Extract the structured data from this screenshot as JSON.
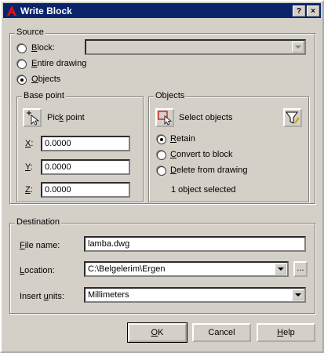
{
  "window": {
    "title": "Write Block",
    "help_button": "?",
    "close_button": "×"
  },
  "source": {
    "legend": "Source",
    "block_label": "Block:",
    "entire_drawing_label": "Entire drawing",
    "objects_label": "Objects",
    "selected": "Objects",
    "block_value": ""
  },
  "base_point": {
    "legend": "Base point",
    "pick_point_label": "Pick point",
    "x_label": "X:",
    "x_value": "0.0000",
    "y_label": "Y:",
    "y_value": "0.0000",
    "z_label": "Z:",
    "z_value": "0.0000"
  },
  "objects": {
    "legend": "Objects",
    "select_objects_label": "Select objects",
    "retain_label": "Retain",
    "convert_label": "Convert to block",
    "delete_label": "Delete from drawing",
    "selected": "Retain",
    "status": "1 object selected"
  },
  "destination": {
    "legend": "Destination",
    "file_name_label": "File name:",
    "file_name_value": "lamba.dwg",
    "location_label": "Location:",
    "location_value": "C:\\Belgelerim\\Ergen",
    "browse_label": "...",
    "insert_units_label": "Insert units:",
    "insert_units_value": "Millimeters"
  },
  "buttons": {
    "ok": "OK",
    "cancel": "Cancel",
    "help": "Help"
  }
}
